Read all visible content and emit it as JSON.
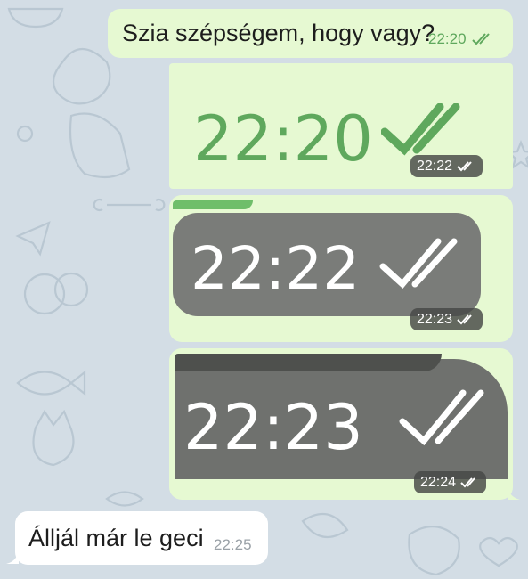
{
  "chat": {
    "messages": [
      {
        "direction": "outgoing",
        "text": "Szia szépségem, hogy vagy?",
        "time": "22:20",
        "status": "read"
      },
      {
        "direction": "outgoing",
        "type": "image",
        "image_text": "22:20",
        "time": "22:22",
        "status": "read"
      },
      {
        "direction": "outgoing",
        "type": "image",
        "image_text": "22:22",
        "time": "22:23",
        "status": "read"
      },
      {
        "direction": "outgoing",
        "type": "image",
        "image_text": "22:23",
        "time": "22:24",
        "status": "read"
      },
      {
        "direction": "incoming",
        "text": "Álljál már le geci",
        "time": "22:25"
      }
    ]
  },
  "colors": {
    "outgoing_bubble": "#e6f9d2",
    "incoming_bubble": "#ffffff",
    "check_green": "#5fa85d",
    "wallpaper": "#d3dde5"
  },
  "icons": {
    "read_receipt": "double-check-icon"
  }
}
